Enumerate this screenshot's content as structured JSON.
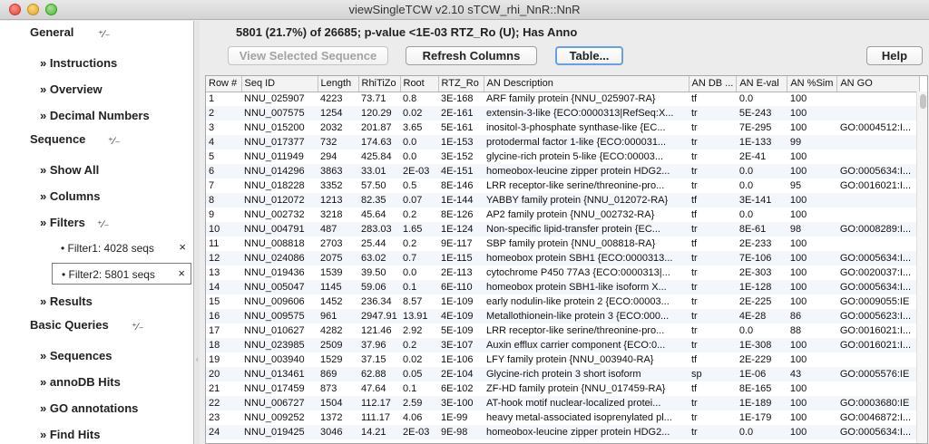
{
  "window": {
    "title": "viewSingleTCW v2.10    sTCW_rhi_NnR::NnR"
  },
  "sidebar": {
    "sections": [
      {
        "label": "General",
        "items": [
          "Instructions",
          "Overview",
          "Decimal Numbers"
        ]
      },
      {
        "label": "Sequence",
        "items": [
          "Show All",
          "Columns",
          "Filters"
        ],
        "filters": [
          "Filter1: 4028 seqs",
          "Filter2: 5801 seqs"
        ],
        "after": [
          "Results"
        ]
      },
      {
        "label": "Basic Queries",
        "items": [
          "Sequences",
          "annoDB Hits",
          "GO annotations",
          "Find Hits"
        ]
      }
    ],
    "expand_glyph": "⁺∕₋",
    "item_prefix": "»",
    "filter_bullet": "•",
    "close_glyph": "×"
  },
  "main": {
    "summary": "5801 (21.7%) of 26685;  p-value <1E-03 RTZ_Ro (U); Has Anno",
    "buttons": {
      "view_selected": "View Selected Sequence",
      "refresh": "Refresh Columns",
      "table": "Table...",
      "help": "Help"
    },
    "table": {
      "columns": [
        "Row #",
        "Seq ID",
        "Length",
        "RhiTiZo",
        "Root",
        "RTZ_Ro",
        "AN Description",
        "AN DB ...",
        "AN E-val",
        "AN %Sim",
        "AN GO"
      ],
      "rows": [
        [
          "1",
          "NNU_025907",
          "4223",
          "73.71",
          "0.8",
          "3E-168",
          "ARF family protein {NNU_025907-RA}",
          "tf",
          "0.0",
          "100",
          ""
        ],
        [
          "2",
          "NNU_007575",
          "1254",
          "120.29",
          "0.02",
          "2E-161",
          "extensin-3-like {ECO:0000313|RefSeq:X...",
          "tr",
          "5E-243",
          "100",
          ""
        ],
        [
          "3",
          "NNU_015200",
          "2032",
          "201.87",
          "3.65",
          "5E-161",
          "inositol-3-phosphate synthase-like {EC...",
          "tr",
          "7E-295",
          "100",
          "GO:0004512:I..."
        ],
        [
          "4",
          "NNU_017377",
          "732",
          "174.63",
          "0.0",
          "1E-153",
          "protodermal factor 1-like {ECO:000031...",
          "tr",
          "1E-133",
          "99",
          ""
        ],
        [
          "5",
          "NNU_011949",
          "294",
          "425.84",
          "0.0",
          "3E-152",
          "glycine-rich protein 5-like {ECO:00003...",
          "tr",
          "2E-41",
          "100",
          ""
        ],
        [
          "6",
          "NNU_014296",
          "3863",
          "33.01",
          "2E-03",
          "4E-151",
          "homeobox-leucine zipper protein HDG2...",
          "tr",
          "0.0",
          "100",
          "GO:0005634:I..."
        ],
        [
          "7",
          "NNU_018228",
          "3352",
          "57.50",
          "0.5",
          "8E-146",
          "LRR receptor-like serine/threonine-pro...",
          "tr",
          "0.0",
          "95",
          "GO:0016021:I..."
        ],
        [
          "8",
          "NNU_012072",
          "1213",
          "82.35",
          "0.07",
          "1E-144",
          "YABBY family protein {NNU_012072-RA}",
          "tf",
          "3E-141",
          "100",
          ""
        ],
        [
          "9",
          "NNU_002732",
          "3218",
          "45.64",
          "0.2",
          "8E-126",
          "AP2 family protein {NNU_002732-RA}",
          "tf",
          "0.0",
          "100",
          ""
        ],
        [
          "10",
          "NNU_004791",
          "487",
          "283.03",
          "1.65",
          "1E-124",
          "Non-specific lipid-transfer protein {EC...",
          "tr",
          "8E-61",
          "98",
          "GO:0008289:I..."
        ],
        [
          "11",
          "NNU_008818",
          "2703",
          "25.44",
          "0.2",
          "9E-117",
          "SBP family protein {NNU_008818-RA}",
          "tf",
          "2E-233",
          "100",
          ""
        ],
        [
          "12",
          "NNU_024086",
          "2075",
          "63.02",
          "0.7",
          "1E-115",
          "homeobox protein SBH1 {ECO:0000313...",
          "tr",
          "7E-106",
          "100",
          "GO:0005634:I..."
        ],
        [
          "13",
          "NNU_019436",
          "1539",
          "39.50",
          "0.0",
          "2E-113",
          "cytochrome P450 77A3 {ECO:0000313|...",
          "tr",
          "2E-303",
          "100",
          "GO:0020037:I..."
        ],
        [
          "14",
          "NNU_005047",
          "1145",
          "59.06",
          "0.1",
          "6E-110",
          "homeobox protein SBH1-like isoform X...",
          "tr",
          "1E-128",
          "100",
          "GO:0005634:I..."
        ],
        [
          "15",
          "NNU_009606",
          "1452",
          "236.34",
          "8.57",
          "1E-109",
          "early nodulin-like protein 2 {ECO:00003...",
          "tr",
          "2E-225",
          "100",
          "GO:0009055:IE"
        ],
        [
          "16",
          "NNU_009575",
          "961",
          "2947.91",
          "13.91",
          "4E-109",
          "Metallothionein-like protein 3 {ECO:000...",
          "tr",
          "4E-28",
          "86",
          "GO:0005623:I..."
        ],
        [
          "17",
          "NNU_010627",
          "4282",
          "121.46",
          "2.92",
          "5E-109",
          "LRR receptor-like serine/threonine-pro...",
          "tr",
          "0.0",
          "88",
          "GO:0016021:I..."
        ],
        [
          "18",
          "NNU_023985",
          "2509",
          "37.96",
          "0.2",
          "3E-107",
          "Auxin efflux carrier component {ECO:0...",
          "tr",
          "1E-308",
          "100",
          "GO:0016021:I..."
        ],
        [
          "19",
          "NNU_003940",
          "1529",
          "37.15",
          "0.02",
          "1E-106",
          "LFY family protein {NNU_003940-RA}",
          "tf",
          "2E-229",
          "100",
          ""
        ],
        [
          "20",
          "NNU_013461",
          "869",
          "62.88",
          "0.05",
          "2E-104",
          "Glycine-rich protein 3 short isoform",
          "sp",
          "1E-06",
          "43",
          "GO:0005576:IE"
        ],
        [
          "21",
          "NNU_017459",
          "873",
          "47.64",
          "0.1",
          "6E-102",
          "ZF-HD family protein {NNU_017459-RA}",
          "tf",
          "8E-165",
          "100",
          ""
        ],
        [
          "22",
          "NNU_006727",
          "1504",
          "112.17",
          "2.59",
          "3E-100",
          "AT-hook motif nuclear-localized protei...",
          "tr",
          "1E-189",
          "100",
          "GO:0003680:IE"
        ],
        [
          "23",
          "NNU_009252",
          "1372",
          "111.17",
          "4.06",
          "1E-99",
          "heavy metal-associated isoprenylated pl...",
          "tr",
          "1E-179",
          "100",
          "GO:0046872:I..."
        ],
        [
          "24",
          "NNU_019425",
          "3046",
          "14.21",
          "2E-03",
          "9E-98",
          "homeobox-leucine zipper protein HDG2...",
          "tr",
          "0.0",
          "100",
          "GO:0005634:I..."
        ]
      ]
    }
  },
  "colors": {
    "row_alt": "#f3f6fa",
    "focus_ring": "#6a9fe1"
  }
}
